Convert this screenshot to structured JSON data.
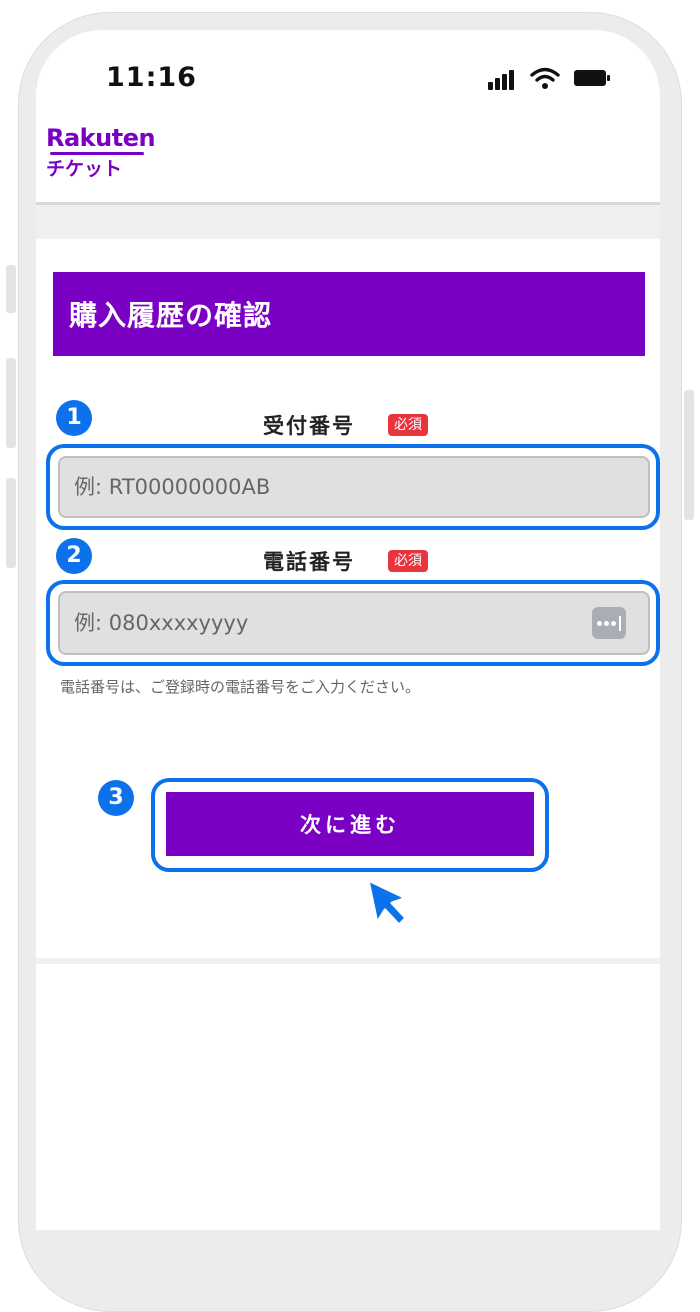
{
  "status_bar": {
    "time": "11:16"
  },
  "brand": {
    "name": "Rakuten",
    "subtitle": "チケット"
  },
  "page": {
    "title": "購入履歴の確認"
  },
  "steps": [
    "1",
    "2",
    "3"
  ],
  "form": {
    "receipt_number": {
      "label": "受付番号",
      "required_badge": "必須",
      "placeholder": "例: RT00000000AB",
      "value": ""
    },
    "phone_number": {
      "label": "電話番号",
      "required_badge": "必須",
      "placeholder": "例: 080xxxxyyyy",
      "value": "",
      "help": "電話番号は、ご登録時の電話番号をご入力ください。"
    },
    "next_button_label": "次に進む"
  },
  "colors": {
    "brand_purple": "#7a00c4",
    "highlight_blue": "#0e71ec",
    "required_red": "#e8353d"
  },
  "icons": [
    "signal-icon",
    "wifi-icon",
    "battery-icon",
    "password-key-icon",
    "pointer-cursor-icon"
  ]
}
